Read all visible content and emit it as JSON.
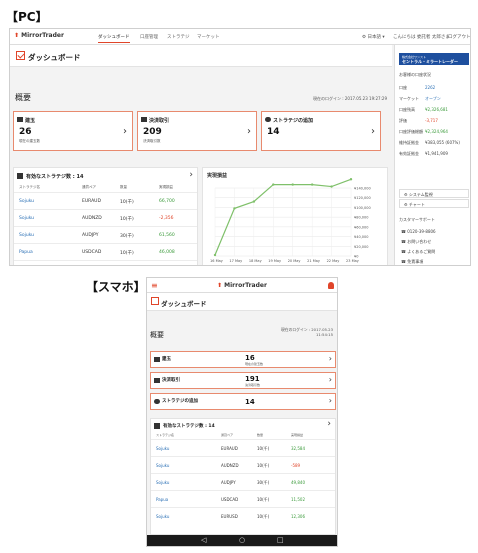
{
  "pc_section_label": "【PC】",
  "sp_section_label": "【スマホ】",
  "pc": {
    "logo": "MirrorTrader",
    "tabs": [
      "ダッシュボード",
      "口座管理",
      "ストラテジ",
      "マーケット"
    ],
    "language": "日本語",
    "greeting": "こんにちは 委託者 太郎さま",
    "logout": "ログアウト",
    "page_title": "ダッシュボード",
    "overview": "概要",
    "last_login": "現在のログイン : 2017.05.23 19:27:29",
    "cards": [
      {
        "title": "建玉",
        "value": "26",
        "sub": "現在の建玉数"
      },
      {
        "title": "決済取引",
        "value": "209",
        "sub": "決済取引数"
      },
      {
        "title": "ストラテジの追加",
        "value": "14",
        "sub": ""
      }
    ],
    "strategy_panel_title": "有効なストラテジ数 : 14",
    "table_headers": [
      "ストラテジ名",
      "通貨ペア",
      "数量",
      "実現損益"
    ],
    "rows": [
      {
        "name": "Sojuku",
        "pair": "EURAUD",
        "qty": "10(千)",
        "pnl": "66,700",
        "sign": "pos"
      },
      {
        "name": "Sojuku",
        "pair": "AUDNZD",
        "qty": "10(千)",
        "pnl": "-2,356",
        "sign": "neg"
      },
      {
        "name": "Sojuku",
        "pair": "AUDJPY",
        "qty": "30(千)",
        "pnl": "61,560",
        "sign": "pos"
      },
      {
        "name": "Papua",
        "pair": "USDCAD",
        "qty": "10(千)",
        "pnl": "46,008",
        "sign": "pos"
      },
      {
        "name": "Sojuku",
        "pair": "EURUSD",
        "qty": "10(千)",
        "pnl": "-5,159",
        "sign": "neg"
      }
    ],
    "chart_panel_title": "実現損益",
    "side": {
      "brand_line1": "株式会社ワンスト",
      "brand_line2": "セントラル・ミラートレーダー",
      "account_heading": "お客様の口座状況",
      "items": [
        {
          "label": "口座",
          "value": "2262",
          "color": "#2a6fb5"
        },
        {
          "label": "マーケット",
          "value": "オープン",
          "color": "#2a6fb5"
        },
        {
          "label": "口座残高",
          "value": "¥2,326,681",
          "color": "#3a9a3a"
        },
        {
          "label": "評価",
          "value": "-3,717",
          "color": "#e0452a"
        },
        {
          "label": "口座評価総額",
          "value": "¥2,324,964",
          "color": "#3a9a3a"
        },
        {
          "label": "維持証拠金",
          "value": "¥383,055 (607%)",
          "color": "#444"
        },
        {
          "label": "有効証拠金",
          "value": "¥1,941,909",
          "color": "#444"
        }
      ],
      "buttons": [
        "システム監視",
        "チャート"
      ],
      "support_heading": "カスタマーサポート",
      "support_items": [
        "0120-39-8806",
        "お問い合わせ",
        "よくあるご質問",
        "免責事項"
      ]
    }
  },
  "chart_data": {
    "type": "line",
    "title": "実現損益",
    "xlabel": "",
    "ylabel": "",
    "x": [
      "16 May",
      "17 May",
      "18 May",
      "19 May",
      "20 May",
      "21 May",
      "22 May",
      "23 May"
    ],
    "series": [
      {
        "values": [
          2000,
          98000,
          112000,
          147000,
          147000,
          147000,
          143000,
          158000
        ]
      }
    ],
    "ylim": [
      0,
      140000
    ],
    "yticks": [
      "¥140,000",
      "¥120,000",
      "¥100,000",
      "¥80,000",
      "¥60,000",
      "¥40,000",
      "¥20,000",
      "¥0"
    ],
    "grid": true,
    "color": "#7fc06a"
  },
  "sp": {
    "logo": "MirrorTrader",
    "page_title": "ダッシュボード",
    "overview": "概要",
    "last_login_line1": "現在のログイン : 2017.05.23",
    "last_login_line2": "11:54:15",
    "cards": [
      {
        "title": "建玉",
        "value": "16",
        "sub": "現在の建玉数"
      },
      {
        "title": "決済取引",
        "value": "191",
        "sub": "決済取引数"
      },
      {
        "title": "ストラテジの追加",
        "value": "14",
        "sub": ""
      }
    ],
    "strategy_panel_title": "有効なストラテジ数 : 14",
    "table_headers": [
      "ストラテジ名",
      "通貨ペア",
      "数量",
      "実現損益"
    ],
    "rows": [
      {
        "name": "Sojuku",
        "pair": "EURAUD",
        "qty": "10(千)",
        "pnl": "32,584",
        "sign": "pos"
      },
      {
        "name": "Sojuku",
        "pair": "AUDNZD",
        "qty": "10(千)",
        "pnl": "-589",
        "sign": "neg"
      },
      {
        "name": "Sojuku",
        "pair": "AUDJPY",
        "qty": "30(千)",
        "pnl": "49,840",
        "sign": "pos"
      },
      {
        "name": "Papua",
        "pair": "USDCAD",
        "qty": "10(千)",
        "pnl": "11,502",
        "sign": "pos"
      },
      {
        "name": "Sojuku",
        "pair": "EURUSD",
        "qty": "10(千)",
        "pnl": "12,306",
        "sign": "pos"
      }
    ],
    "nav_icons": [
      "back-icon",
      "home-icon",
      "recent-apps-icon"
    ]
  }
}
